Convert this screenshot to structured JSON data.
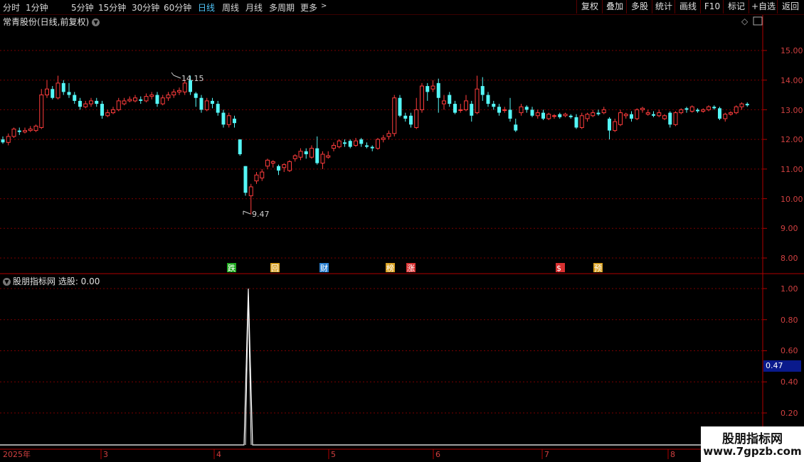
{
  "toolbar": {
    "periods": [
      "分时",
      "1分钟",
      "5分钟",
      "15分钟",
      "30分钟",
      "60分钟",
      "日线",
      "周线",
      "月线",
      "更多"
    ],
    "active_period": "日线",
    "right_buttons": [
      "复权",
      "叠加",
      "多股",
      "统计",
      "画线",
      "F10",
      "标记",
      "+自选",
      "返回"
    ]
  },
  "main_chart": {
    "stock_name": "常青股份(日线,前复权)",
    "y_ticks": [
      "15.00",
      "14.00",
      "13.00",
      "12.00",
      "11.00",
      "10.00",
      "9.00",
      "8.00"
    ],
    "high_label": "14.15",
    "low_label": "9.47",
    "event_markers": [
      "跌",
      "回",
      "财",
      "榜",
      "涨",
      "$",
      "预"
    ]
  },
  "indicator": {
    "name": "股朋指标网 选股: 0.00",
    "y_ticks": [
      "1.00",
      "0.80",
      "0.60",
      "0.40",
      "0.20"
    ],
    "current_value": "0.47"
  },
  "time_axis": {
    "labels": [
      "2025年",
      "3",
      "4",
      "5",
      "6",
      "7",
      "8"
    ]
  },
  "watermark": {
    "title": "股朋指标网",
    "url": "www.7gpzb.com"
  },
  "colors": {
    "up": "#ff3c3c",
    "down": "#54f6f6",
    "grid": "#7a0000",
    "axis": "#b00000",
    "active": "#4fc3f7"
  },
  "chart_data": [
    {
      "type": "candlestick",
      "title": "常青股份(日线,前复权)",
      "ylim": [
        7.6,
        15.5
      ],
      "high": 14.15,
      "low": 9.47,
      "candles": [
        [
          12.0,
          11.9,
          12.1,
          11.85
        ],
        [
          11.9,
          12.1,
          12.2,
          11.8
        ],
        [
          12.1,
          12.35,
          12.4,
          12.05
        ],
        [
          12.3,
          12.25,
          12.4,
          12.15
        ],
        [
          12.25,
          12.3,
          12.4,
          12.2
        ],
        [
          12.3,
          12.35,
          12.45,
          12.25
        ],
        [
          12.3,
          12.45,
          12.5,
          12.25
        ],
        [
          12.4,
          13.5,
          13.7,
          12.35
        ],
        [
          13.5,
          13.7,
          14.0,
          13.4
        ],
        [
          13.7,
          13.4,
          13.8,
          13.35
        ],
        [
          13.4,
          13.9,
          14.15,
          13.35
        ],
        [
          13.9,
          13.6,
          14.0,
          13.5
        ],
        [
          13.6,
          13.5,
          13.9,
          13.4
        ],
        [
          13.5,
          13.3,
          13.6,
          13.2
        ],
        [
          13.3,
          13.1,
          13.4,
          13.0
        ],
        [
          13.1,
          13.2,
          13.3,
          13.05
        ],
        [
          13.2,
          13.3,
          13.4,
          13.1
        ],
        [
          13.3,
          13.2,
          13.4,
          13.1
        ],
        [
          13.2,
          12.8,
          13.3,
          12.7
        ],
        [
          12.8,
          12.9,
          13.0,
          12.75
        ],
        [
          12.9,
          13.0,
          13.1,
          12.85
        ],
        [
          13.0,
          13.3,
          13.4,
          12.95
        ],
        [
          13.2,
          13.3,
          13.4,
          13.15
        ],
        [
          13.3,
          13.35,
          13.45,
          13.25
        ],
        [
          13.3,
          13.4,
          13.5,
          13.25
        ],
        [
          13.35,
          13.3,
          13.45,
          13.2
        ],
        [
          13.3,
          13.45,
          13.55,
          13.25
        ],
        [
          13.45,
          13.5,
          13.6,
          13.35
        ],
        [
          13.5,
          13.2,
          13.6,
          13.1
        ],
        [
          13.2,
          13.4,
          13.5,
          13.15
        ],
        [
          13.4,
          13.5,
          13.6,
          13.3
        ],
        [
          13.5,
          13.6,
          13.7,
          13.4
        ],
        [
          13.6,
          13.65,
          13.75,
          13.5
        ],
        [
          13.6,
          13.9,
          14.0,
          13.5
        ],
        [
          14.0,
          13.6,
          14.15,
          13.5
        ],
        [
          13.55,
          13.4,
          13.6,
          13.1
        ],
        [
          13.4,
          13.0,
          13.5,
          12.9
        ],
        [
          13.0,
          13.3,
          13.4,
          12.95
        ],
        [
          13.3,
          13.2,
          13.4,
          13.05
        ],
        [
          13.2,
          12.9,
          13.3,
          12.8
        ],
        [
          12.9,
          12.5,
          13.0,
          12.4
        ],
        [
          12.5,
          12.8,
          12.9,
          12.4
        ],
        [
          12.7,
          12.55,
          12.8,
          12.4
        ],
        [
          12.0,
          11.5,
          12.0,
          11.45
        ],
        [
          11.1,
          10.2,
          11.1,
          10.1
        ],
        [
          10.1,
          10.4,
          10.5,
          9.47
        ],
        [
          10.6,
          10.8,
          10.9,
          10.5
        ],
        [
          10.7,
          10.9,
          11.0,
          10.6
        ],
        [
          11.1,
          11.3,
          11.35,
          11.0
        ],
        [
          11.2,
          11.25,
          11.3,
          11.05
        ],
        [
          11.1,
          10.95,
          11.15,
          10.8
        ],
        [
          11.05,
          11.15,
          11.2,
          10.9
        ],
        [
          10.95,
          11.25,
          11.3,
          10.9
        ],
        [
          11.35,
          11.45,
          11.5,
          11.25
        ],
        [
          11.4,
          11.6,
          11.7,
          11.3
        ],
        [
          11.6,
          11.5,
          11.7,
          11.35
        ],
        [
          11.4,
          11.7,
          11.8,
          11.35
        ],
        [
          11.7,
          11.2,
          12.1,
          11.15
        ],
        [
          11.2,
          11.5,
          11.6,
          11.0
        ],
        [
          11.4,
          11.45,
          11.6,
          11.35
        ],
        [
          11.7,
          11.8,
          11.9,
          11.6
        ],
        [
          11.75,
          11.95,
          12.0,
          11.7
        ],
        [
          11.9,
          11.85,
          12.0,
          11.75
        ],
        [
          11.95,
          11.75,
          12.0,
          11.7
        ],
        [
          11.8,
          11.95,
          12.05,
          11.75
        ],
        [
          12.0,
          11.85,
          12.05,
          11.75
        ],
        [
          11.8,
          11.75,
          11.9,
          11.7
        ],
        [
          11.75,
          11.7,
          11.8,
          11.6
        ],
        [
          11.7,
          12.0,
          12.05,
          11.65
        ],
        [
          12.0,
          12.05,
          12.15,
          11.9
        ],
        [
          12.1,
          12.2,
          12.3,
          12.0
        ],
        [
          12.2,
          13.4,
          13.5,
          12.1
        ],
        [
          13.4,
          12.8,
          13.5,
          12.75
        ],
        [
          12.8,
          12.7,
          12.9,
          12.6
        ],
        [
          12.8,
          12.5,
          12.9,
          12.4
        ],
        [
          12.4,
          13.0,
          13.4,
          12.35
        ],
        [
          13.0,
          13.8,
          13.9,
          12.9
        ],
        [
          13.8,
          13.6,
          13.9,
          13.3
        ],
        [
          13.7,
          13.8,
          14.0,
          13.6
        ],
        [
          13.9,
          13.4,
          14.05,
          12.9
        ],
        [
          13.2,
          13.3,
          13.5,
          13.0
        ],
        [
          13.5,
          13.2,
          13.6,
          13.1
        ],
        [
          13.2,
          12.9,
          13.3,
          12.85
        ],
        [
          13.0,
          13.0,
          13.2,
          12.9
        ],
        [
          13.0,
          13.3,
          13.5,
          12.95
        ],
        [
          13.2,
          12.8,
          13.3,
          12.6
        ],
        [
          12.9,
          13.7,
          14.15,
          12.85
        ],
        [
          13.8,
          13.5,
          14.1,
          13.3
        ],
        [
          13.5,
          13.2,
          13.6,
          13.1
        ],
        [
          13.2,
          13.1,
          13.3,
          13.0
        ],
        [
          13.1,
          12.9,
          13.2,
          12.8
        ],
        [
          13.0,
          13.0,
          13.1,
          12.9
        ],
        [
          13.0,
          12.7,
          13.4,
          12.6
        ],
        [
          12.5,
          12.3,
          12.7,
          12.25
        ],
        [
          12.9,
          13.1,
          13.2,
          12.8
        ],
        [
          13.1,
          13.0,
          13.15,
          12.9
        ],
        [
          13.0,
          12.8,
          13.1,
          12.75
        ],
        [
          12.8,
          12.9,
          13.0,
          12.7
        ],
        [
          12.9,
          12.7,
          13.0,
          12.65
        ],
        [
          12.7,
          12.85,
          12.9,
          12.65
        ],
        [
          12.8,
          12.8,
          12.85,
          12.7
        ],
        [
          12.85,
          12.75,
          12.9,
          12.7
        ],
        [
          12.8,
          12.85,
          12.9,
          12.75
        ],
        [
          12.8,
          12.75,
          12.85,
          12.7
        ],
        [
          12.75,
          12.4,
          12.85,
          12.35
        ],
        [
          12.4,
          12.8,
          12.9,
          12.35
        ],
        [
          12.7,
          12.85,
          12.9,
          12.6
        ],
        [
          12.8,
          12.9,
          13.0,
          12.75
        ],
        [
          12.9,
          12.85,
          13.0,
          12.8
        ],
        [
          12.9,
          13.0,
          13.1,
          12.85
        ],
        [
          12.7,
          12.3,
          12.75,
          12.0
        ],
        [
          12.3,
          12.6,
          12.7,
          12.25
        ],
        [
          12.5,
          12.9,
          13.0,
          12.45
        ],
        [
          12.8,
          12.85,
          12.9,
          12.7
        ],
        [
          12.85,
          12.7,
          12.95,
          12.6
        ],
        [
          12.7,
          13.0,
          13.05,
          12.65
        ],
        [
          13.0,
          13.05,
          13.1,
          12.9
        ],
        [
          12.85,
          12.9,
          13.0,
          12.8
        ],
        [
          12.85,
          12.8,
          12.95,
          12.75
        ],
        [
          12.8,
          12.9,
          13.0,
          12.75
        ],
        [
          12.7,
          12.8,
          12.85,
          12.65
        ],
        [
          12.9,
          12.5,
          12.95,
          12.4
        ],
        [
          12.5,
          12.9,
          12.95,
          12.45
        ],
        [
          12.9,
          13.0,
          13.05,
          12.85
        ],
        [
          13.05,
          13.0,
          13.1,
          12.9
        ],
        [
          12.95,
          13.1,
          13.15,
          12.9
        ],
        [
          13.0,
          12.95,
          13.05,
          12.9
        ],
        [
          12.95,
          13.0,
          13.05,
          12.9
        ],
        [
          13.0,
          13.1,
          13.15,
          12.95
        ],
        [
          13.1,
          13.05,
          13.15,
          13.0
        ],
        [
          13.05,
          12.7,
          13.1,
          12.65
        ],
        [
          12.7,
          12.85,
          12.9,
          12.6
        ],
        [
          12.85,
          12.9,
          12.95,
          12.8
        ],
        [
          12.9,
          13.1,
          13.15,
          12.85
        ],
        [
          13.1,
          13.2,
          13.25,
          13.0
        ],
        [
          13.2,
          13.15,
          13.25,
          13.1
        ]
      ]
    },
    {
      "type": "line",
      "title": "股朋指标网 选股",
      "ylim": [
        0,
        1.1
      ],
      "x": [
        "2025-04-14",
        "2025-04-15",
        "2025-04-16"
      ],
      "values": [
        0,
        1,
        0
      ]
    }
  ]
}
